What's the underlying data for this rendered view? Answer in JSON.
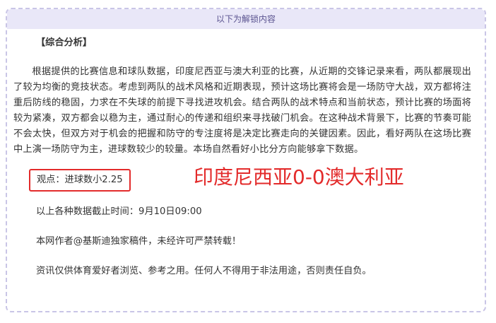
{
  "unlock_header": "以下为解锁内容",
  "section_title": "【综合分析】",
  "analysis_paragraph": "根据提供的比赛信息和球队数据，印度尼西亚与澳大利亚的比赛，从近期的交锋记录来看，两队都展现出了较为均衡的竞技状态。考虑到两队的战术风格和近期表现，预计这场比赛将会是一场防守大战，双方都将注重后防线的稳固，力求在不失球的前提下寻找进攻机会。结合两队的战术特点和当前状态，预计比赛的场面将较为紧凑，双方都会以稳为主，通过耐心的传递和组织来寻找破门机会。在这种战术背景下，比赛的节奏可能不会太快，但双方对于机会的把握和防守的专注度将是决定比赛走向的关键因素。因此，看好两队在这场比赛中上演一场防守为主，进球数较少的较量。本场自然看好小比分方向能够拿下数据。",
  "viewpoint": "观点：进球数小2.25",
  "score_prediction": "印度尼西亚0-0澳大利亚",
  "cutoff_time": "以上各种数据截止时间：9月10日09:00",
  "author_note": "本网作者@基斯迪独家稿件，未经许可严禁转载！",
  "disclaimer": "资讯仅供体育爱好者浏览、参考之用。任何人不得用于非法用途，否则责任自负。",
  "colors": {
    "accent_red": "#e32b2b",
    "header_bg": "#e9e7f8",
    "header_text": "#5b5490",
    "border": "#c9c5e6"
  }
}
